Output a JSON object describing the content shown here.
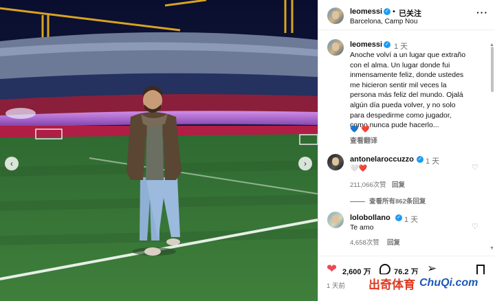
{
  "post": {
    "username": "leomessi",
    "follow_label": "已关注",
    "location": "Barcelona, Camp Nou",
    "more_label": "···",
    "caption_time": "1 天",
    "caption": [
      "Anoche volví a un lugar que extraño",
      "con el alma. Un lugar donde fui",
      "inmensamente feliz, donde ustedes",
      "me hicieron sentir mil veces la",
      "persona más feliz del mundo. Ojalá",
      "algún día pueda volver, y no solo",
      "para despedirme como jugador,",
      "como nunca pude hacerlo..."
    ],
    "caption_emojis": [
      "💙",
      "❤️"
    ],
    "see_translation": "查看翻译"
  },
  "comments": [
    {
      "username": "antonelaroccuzzo",
      "time": "1 天",
      "text": "🤍❤️",
      "likes": "211,066次赞",
      "reply_label": "回复"
    },
    {
      "username": "lolobollano",
      "time": "1 天",
      "text": "Te amo",
      "likes": "4,658次赞",
      "reply_label": "回复"
    }
  ],
  "view_replies": "查看所有862条回复",
  "stats": {
    "likes": "2,600 万",
    "comments": "76.2 万",
    "post_time": "1 天前"
  },
  "watermark": {
    "cn": "出奇体育",
    "en": "ChuQi.com"
  },
  "colors": {
    "like_red": "#ed4956",
    "verified_blue": "#1d9bf0",
    "text": "#111111",
    "muted": "#737373"
  },
  "icons": [
    "more-icon",
    "verified-icon",
    "heart-icon",
    "comment-icon",
    "share-icon",
    "bookmark-icon",
    "chevron-left-icon",
    "chevron-right-icon"
  ]
}
